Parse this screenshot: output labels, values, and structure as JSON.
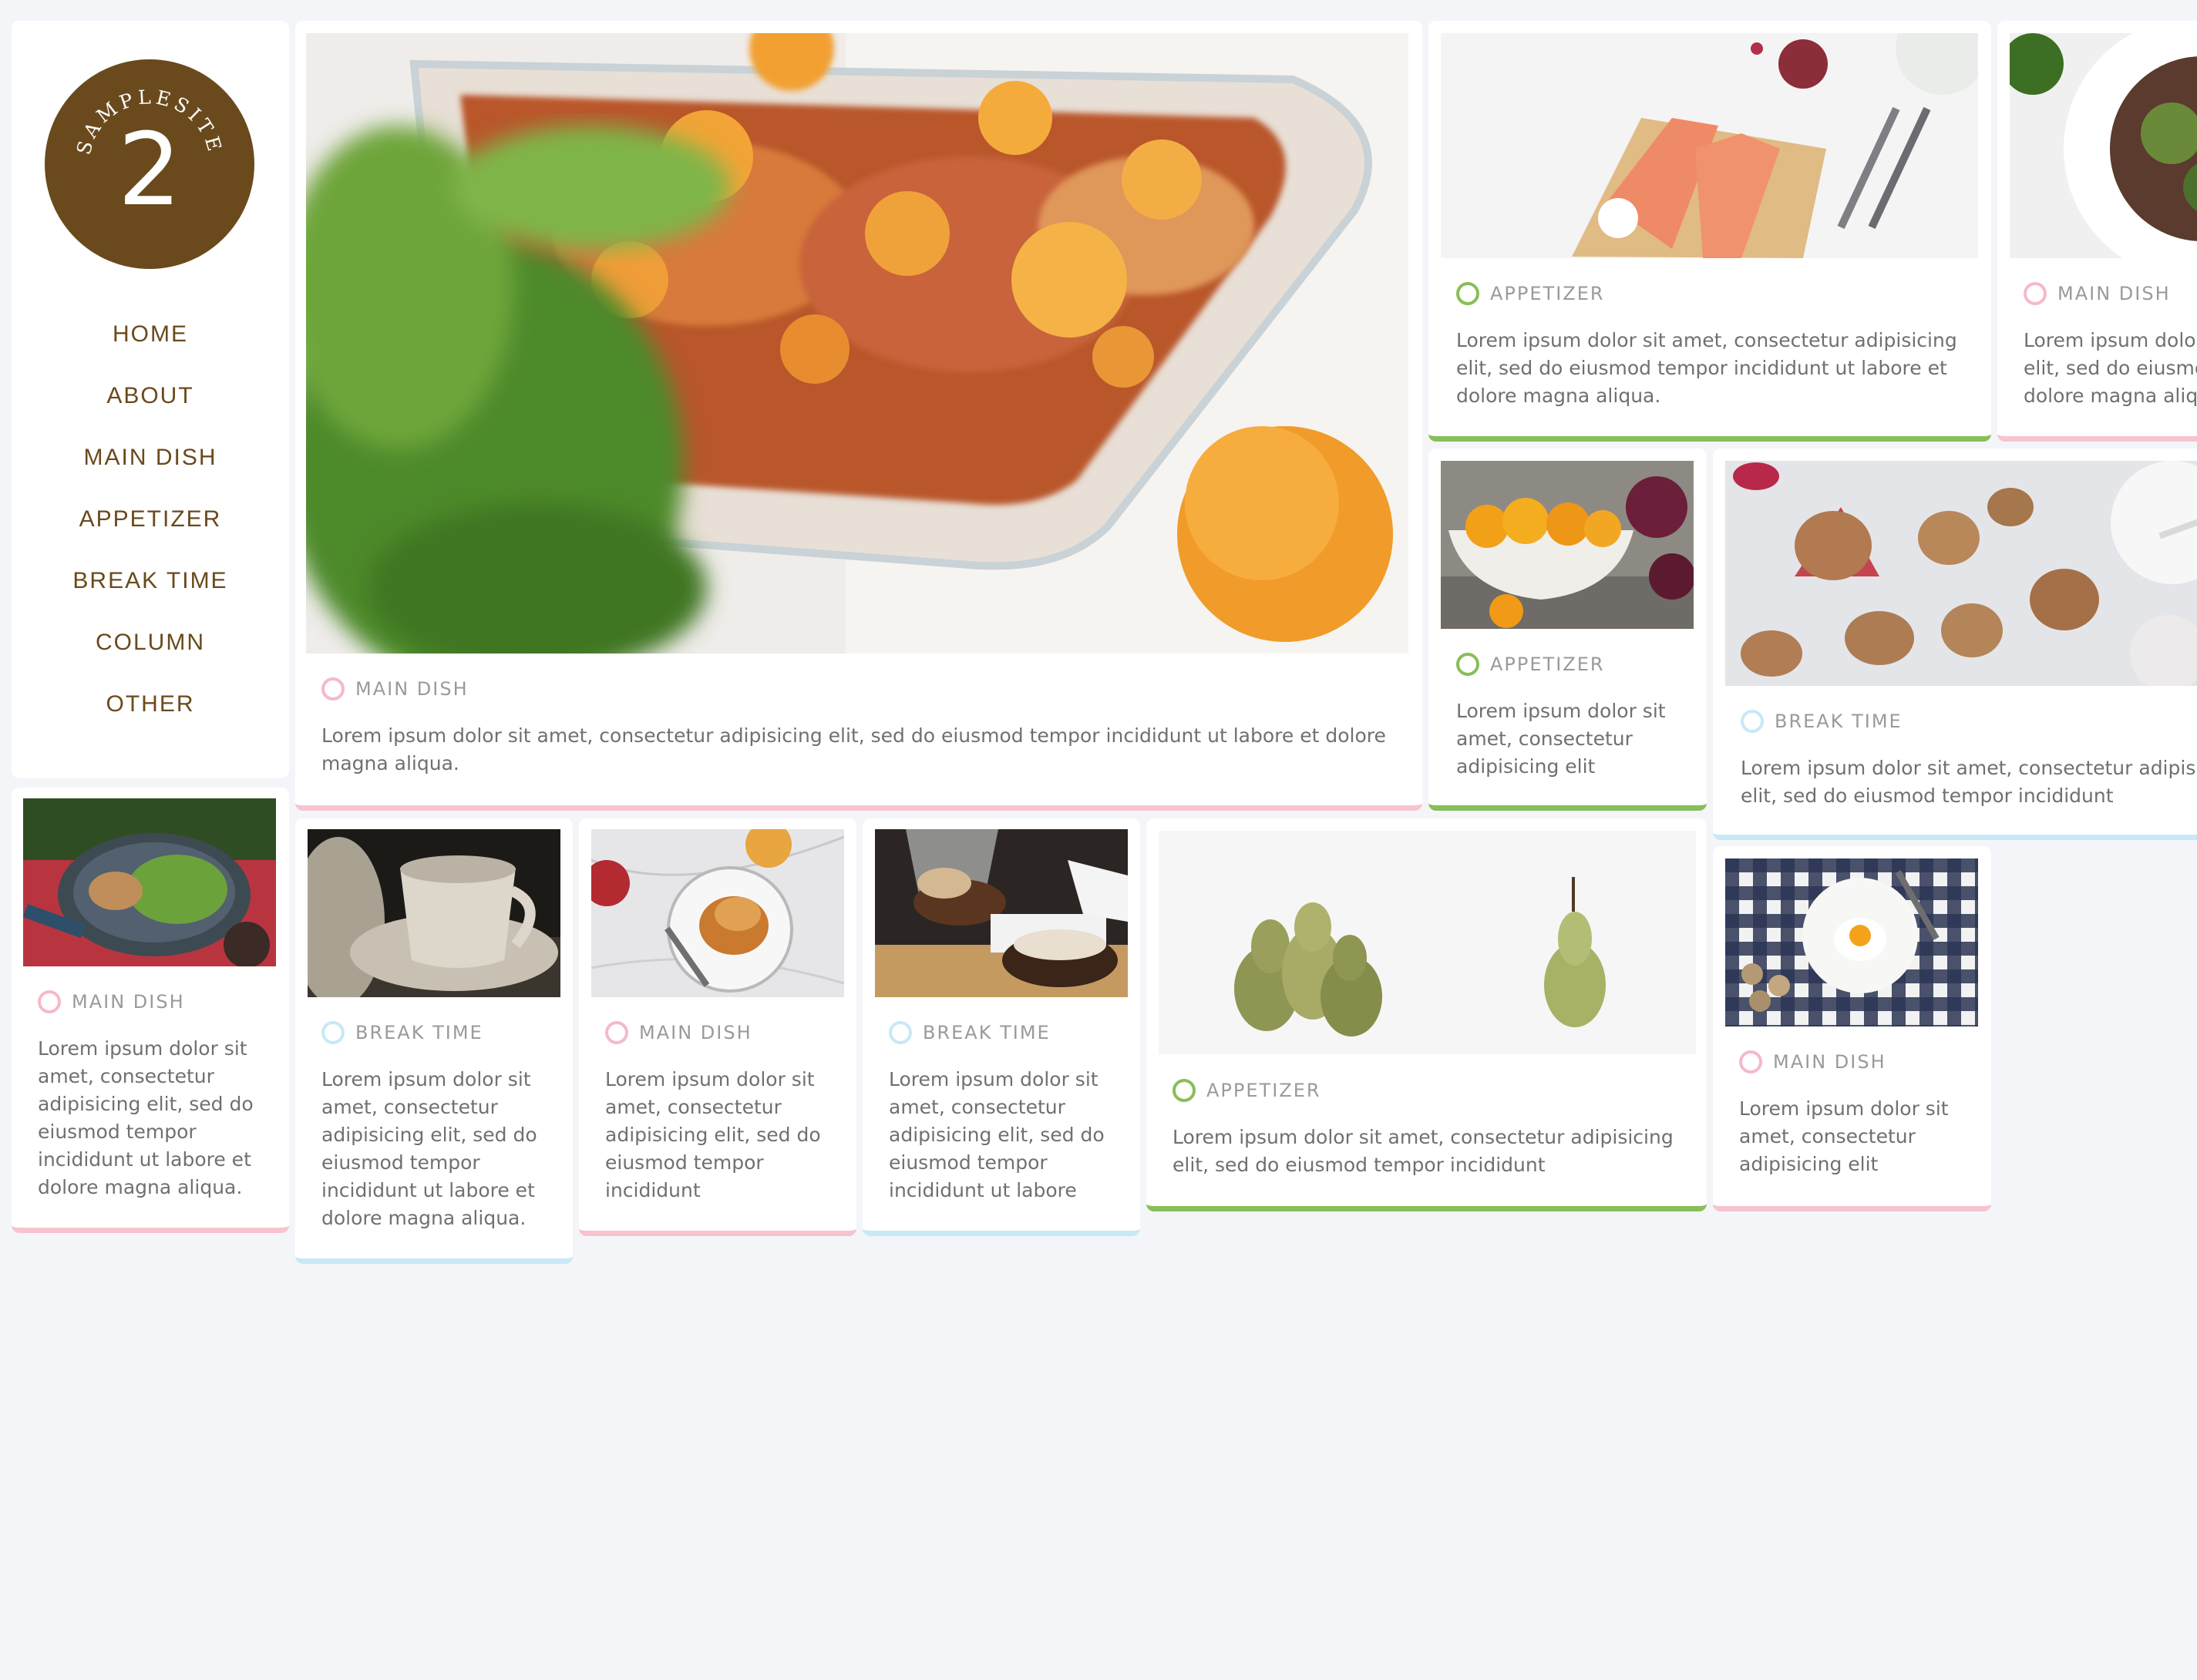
{
  "brand": {
    "logo_arc_text": "SAMPLESITE",
    "logo_number": "2",
    "logo_color": "#6a4a1c"
  },
  "nav": {
    "items": [
      "HOME",
      "ABOUT",
      "MAIN DISH",
      "APPETIZER",
      "BREAK TIME",
      "COLUMN",
      "OTHER"
    ]
  },
  "colors": {
    "main_dish": "#f6c3cf",
    "appetizer": "#87bf58",
    "break_time": "#c8e8f7",
    "background": "#f4f5f9"
  },
  "posts": [
    {
      "id": "featured",
      "category": "MAIN DISH",
      "image": "baked-citrus-chicken-photo",
      "excerpt": "Lorem ipsum dolor sit amet, consectetur adipisicing elit, sed do eiusmod tempor incididunt ut labore et dolore\nmagna aliqua."
    },
    {
      "id": "salmon",
      "category": "APPETIZER",
      "image": "salmon-fillets-photo",
      "excerpt": "Lorem ipsum dolor sit amet, consectetur adipisicing\nelit, sed do eiusmod tempor incididunt ut labore et\ndolore magna aliqua."
    },
    {
      "id": "steak-salad",
      "category": "MAIN DISH",
      "image": "steak-salad-photo",
      "excerpt": "Lorem ipsum dolor\nelit, sed do eiusmo\ndolore magna aliqu"
    },
    {
      "id": "kumquats",
      "category": "APPETIZER",
      "image": "kumquat-bowl-photo",
      "excerpt": "Lorem ipsum dolor sit\namet, consectetur\nadipisicing elit"
    },
    {
      "id": "cookies",
      "category": "BREAK TIME",
      "image": "decorated-cookies-photo",
      "excerpt": "Lorem ipsum dolor sit amet, consectetur adipisicir\nelit, sed do eiusmod tempor incididunt"
    },
    {
      "id": "pan-greens",
      "category": "MAIN DISH",
      "image": "pan-greens-photo",
      "excerpt": "Lorem ipsum dolor sit\namet, consectetur\nadipisicing elit, sed do\neiusmod tempor\nincididunt ut labore et\ndolore magna aliqua."
    },
    {
      "id": "mug",
      "category": "BREAK TIME",
      "image": "ceramic-mug-photo",
      "excerpt": "Lorem ipsum dolor sit\namet, consectetur\nadipisicing elit, sed do\neiusmod tempor\nincididunt ut labore et\ndolore magna aliqua."
    },
    {
      "id": "toast",
      "category": "MAIN DISH",
      "image": "french-toast-photo",
      "excerpt": "Lorem ipsum dolor sit\namet, consectetur\nadipisicing elit, sed do\neiusmod tempor\nincididunt"
    },
    {
      "id": "burger",
      "category": "BREAK TIME",
      "image": "burger-photo",
      "excerpt": "Lorem ipsum dolor sit\namet, consectetur\nadipisicing elit, sed do\neiusmod tempor\nincididunt ut labore"
    },
    {
      "id": "pears",
      "category": "APPETIZER",
      "image": "pears-photo",
      "excerpt": "Lorem ipsum dolor sit amet, consectetur adipisicing\nelit, sed do eiusmod tempor incididunt"
    },
    {
      "id": "egg",
      "category": "MAIN DISH",
      "image": "fried-egg-photo",
      "excerpt": "Lorem ipsum dolor sit\namet, consectetur\nadipisicing elit"
    }
  ]
}
